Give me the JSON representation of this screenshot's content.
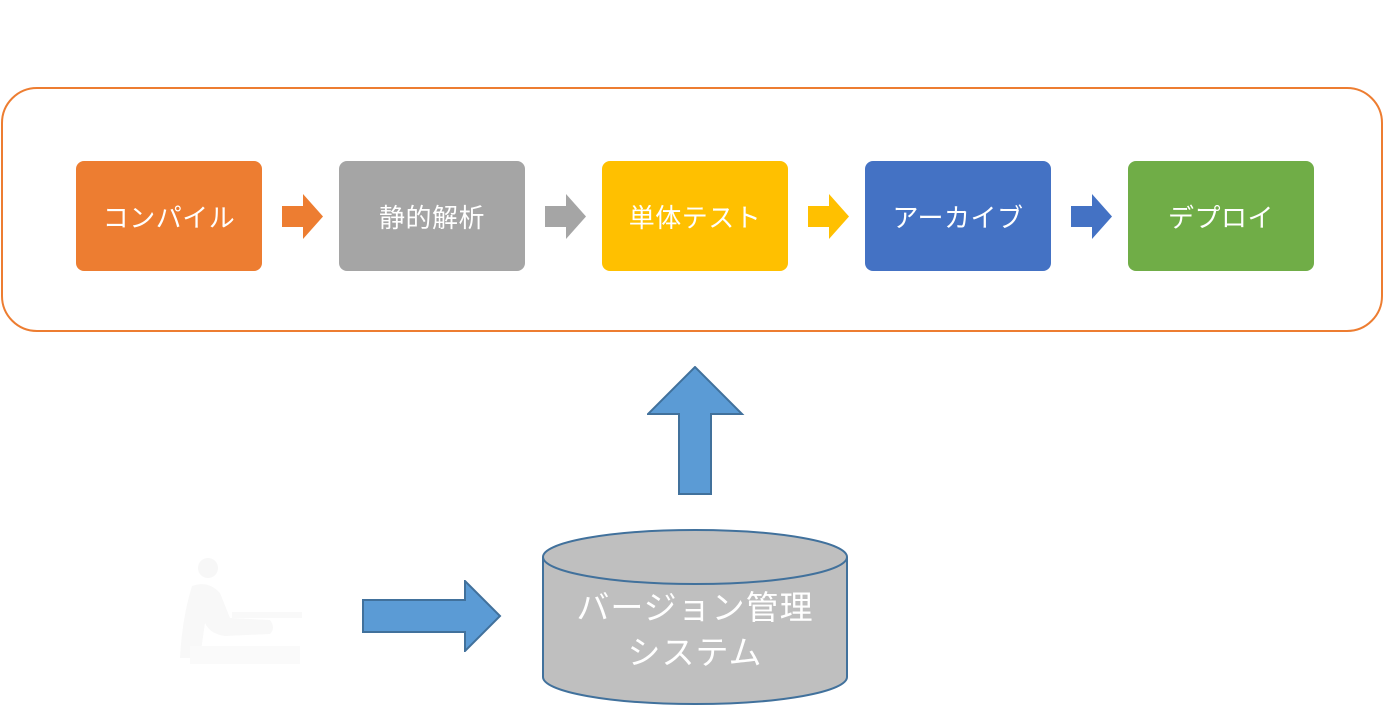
{
  "pipeline": {
    "stages": [
      {
        "label": "コンパイル",
        "color": "#ED7D31"
      },
      {
        "label": "静的解析",
        "color": "#A5A5A5"
      },
      {
        "label": "単体テスト",
        "color": "#FFC000"
      },
      {
        "label": "アーカイブ",
        "color": "#4472C4"
      },
      {
        "label": "デプロイ",
        "color": "#70AD47"
      }
    ],
    "frame_color": "#ED7D31"
  },
  "repository": {
    "label_line1": "バージョン管理",
    "label_line2": "システム",
    "fill": "#BFBFBF",
    "stroke": "#41719C"
  },
  "connectors": {
    "color": "#5B9BD5",
    "stroke": "#41719C"
  }
}
